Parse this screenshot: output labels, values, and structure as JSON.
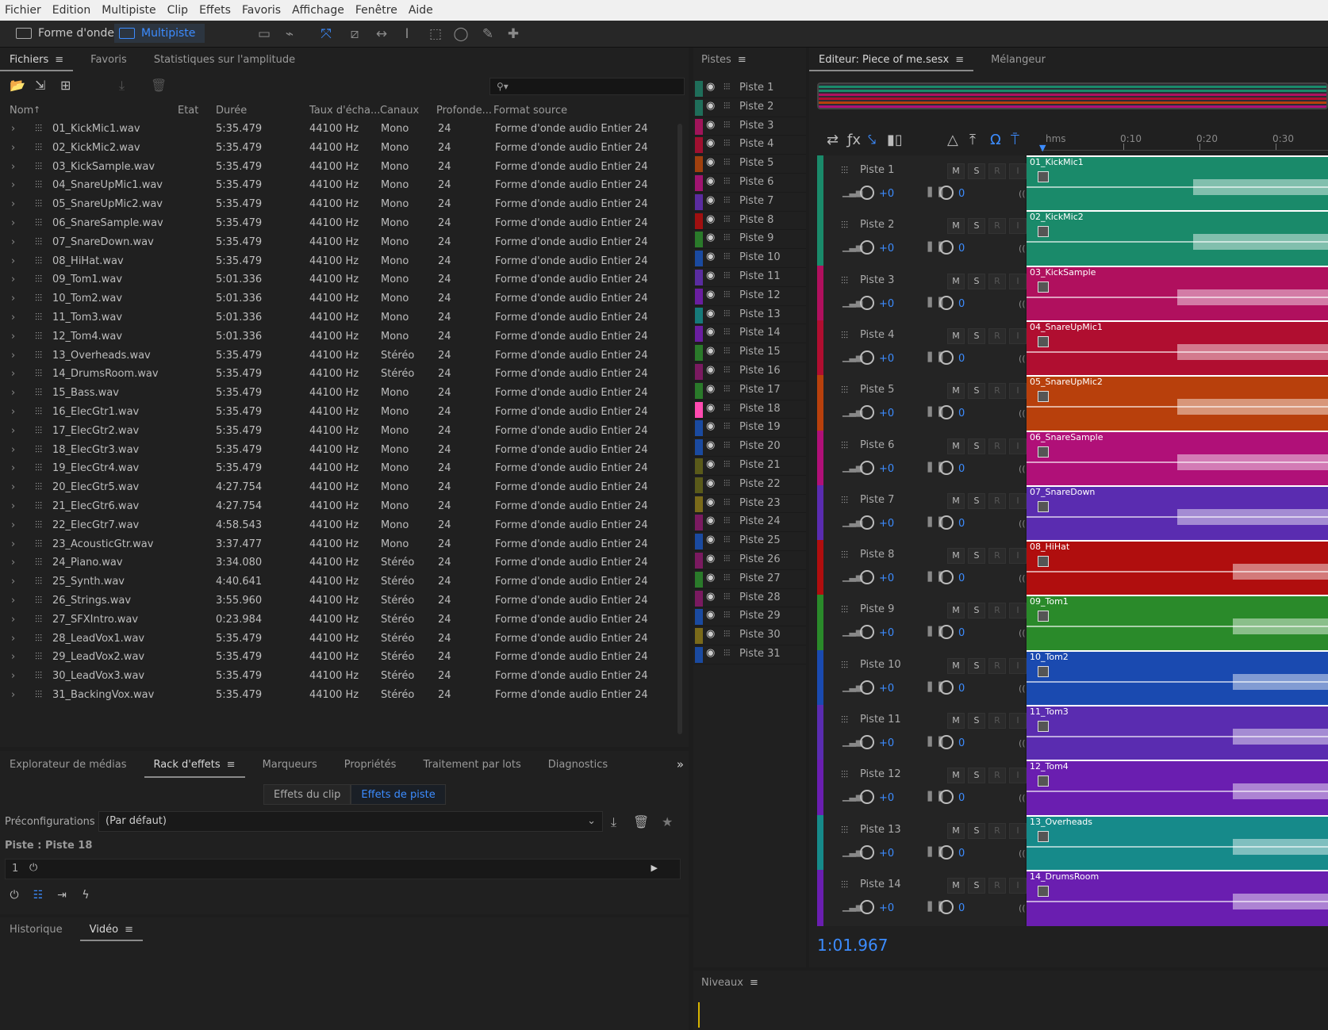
{
  "menu": [
    "Fichier",
    "Edition",
    "Multipiste",
    "Clip",
    "Effets",
    "Favoris",
    "Affichage",
    "Fenêtre",
    "Aide"
  ],
  "modes": {
    "waveform": "Forme d'onde",
    "multitrack": "Multipiste"
  },
  "files_panel": {
    "tabs": [
      "Fichiers",
      "Favoris",
      "Statistiques sur l'amplitude"
    ],
    "columns": [
      "Nom",
      "Etat",
      "Durée",
      "Taux d'écha...",
      "Canaux",
      "Profonde...",
      "Format source"
    ],
    "rows": [
      [
        "01_KickMic1.wav",
        "5:35.479",
        "44100 Hz",
        "Mono",
        "24",
        "Forme d'onde audio Entier 24"
      ],
      [
        "02_KickMic2.wav",
        "5:35.479",
        "44100 Hz",
        "Mono",
        "24",
        "Forme d'onde audio Entier 24"
      ],
      [
        "03_KickSample.wav",
        "5:35.479",
        "44100 Hz",
        "Mono",
        "24",
        "Forme d'onde audio Entier 24"
      ],
      [
        "04_SnareUpMic1.wav",
        "5:35.479",
        "44100 Hz",
        "Mono",
        "24",
        "Forme d'onde audio Entier 24"
      ],
      [
        "05_SnareUpMic2.wav",
        "5:35.479",
        "44100 Hz",
        "Mono",
        "24",
        "Forme d'onde audio Entier 24"
      ],
      [
        "06_SnareSample.wav",
        "5:35.479",
        "44100 Hz",
        "Mono",
        "24",
        "Forme d'onde audio Entier 24"
      ],
      [
        "07_SnareDown.wav",
        "5:35.479",
        "44100 Hz",
        "Mono",
        "24",
        "Forme d'onde audio Entier 24"
      ],
      [
        "08_HiHat.wav",
        "5:35.479",
        "44100 Hz",
        "Mono",
        "24",
        "Forme d'onde audio Entier 24"
      ],
      [
        "09_Tom1.wav",
        "5:01.336",
        "44100 Hz",
        "Mono",
        "24",
        "Forme d'onde audio Entier 24"
      ],
      [
        "10_Tom2.wav",
        "5:01.336",
        "44100 Hz",
        "Mono",
        "24",
        "Forme d'onde audio Entier 24"
      ],
      [
        "11_Tom3.wav",
        "5:01.336",
        "44100 Hz",
        "Mono",
        "24",
        "Forme d'onde audio Entier 24"
      ],
      [
        "12_Tom4.wav",
        "5:01.336",
        "44100 Hz",
        "Mono",
        "24",
        "Forme d'onde audio Entier 24"
      ],
      [
        "13_Overheads.wav",
        "5:35.479",
        "44100 Hz",
        "Stéréo",
        "24",
        "Forme d'onde audio Entier 24"
      ],
      [
        "14_DrumsRoom.wav",
        "5:35.479",
        "44100 Hz",
        "Stéréo",
        "24",
        "Forme d'onde audio Entier 24"
      ],
      [
        "15_Bass.wav",
        "5:35.479",
        "44100 Hz",
        "Mono",
        "24",
        "Forme d'onde audio Entier 24"
      ],
      [
        "16_ElecGtr1.wav",
        "5:35.479",
        "44100 Hz",
        "Mono",
        "24",
        "Forme d'onde audio Entier 24"
      ],
      [
        "17_ElecGtr2.wav",
        "5:35.479",
        "44100 Hz",
        "Mono",
        "24",
        "Forme d'onde audio Entier 24"
      ],
      [
        "18_ElecGtr3.wav",
        "5:35.479",
        "44100 Hz",
        "Mono",
        "24",
        "Forme d'onde audio Entier 24"
      ],
      [
        "19_ElecGtr4.wav",
        "5:35.479",
        "44100 Hz",
        "Mono",
        "24",
        "Forme d'onde audio Entier 24"
      ],
      [
        "20_ElecGtr5.wav",
        "4:27.754",
        "44100 Hz",
        "Mono",
        "24",
        "Forme d'onde audio Entier 24"
      ],
      [
        "21_ElecGtr6.wav",
        "4:27.754",
        "44100 Hz",
        "Mono",
        "24",
        "Forme d'onde audio Entier 24"
      ],
      [
        "22_ElecGtr7.wav",
        "4:58.543",
        "44100 Hz",
        "Mono",
        "24",
        "Forme d'onde audio Entier 24"
      ],
      [
        "23_AcousticGtr.wav",
        "3:37.477",
        "44100 Hz",
        "Mono",
        "24",
        "Forme d'onde audio Entier 24"
      ],
      [
        "24_Piano.wav",
        "3:34.080",
        "44100 Hz",
        "Stéréo",
        "24",
        "Forme d'onde audio Entier 24"
      ],
      [
        "25_Synth.wav",
        "4:40.641",
        "44100 Hz",
        "Stéréo",
        "24",
        "Forme d'onde audio Entier 24"
      ],
      [
        "26_Strings.wav",
        "3:55.960",
        "44100 Hz",
        "Stéréo",
        "24",
        "Forme d'onde audio Entier 24"
      ],
      [
        "27_SFXIntro.wav",
        "0:23.984",
        "44100 Hz",
        "Stéréo",
        "24",
        "Forme d'onde audio Entier 24"
      ],
      [
        "28_LeadVox1.wav",
        "5:35.479",
        "44100 Hz",
        "Stéréo",
        "24",
        "Forme d'onde audio Entier 24"
      ],
      [
        "29_LeadVox2.wav",
        "5:35.479",
        "44100 Hz",
        "Stéréo",
        "24",
        "Forme d'onde audio Entier 24"
      ],
      [
        "30_LeadVox3.wav",
        "5:35.479",
        "44100 Hz",
        "Stéréo",
        "24",
        "Forme d'onde audio Entier 24"
      ],
      [
        "31_BackingVox.wav",
        "5:35.479",
        "44100 Hz",
        "Stéréo",
        "24",
        "Forme d'onde audio Entier 24"
      ]
    ]
  },
  "rack": {
    "tabs": [
      "Explorateur de médias",
      "Rack d'effets",
      "Marqueurs",
      "Propriétés",
      "Traitement par lots",
      "Diagnostics"
    ],
    "subtabs": [
      "Effets du clip",
      "Effets de piste"
    ],
    "preset_label": "Préconfigurations :",
    "preset_value": "(Par défaut)",
    "track_label": "Piste : Piste 18",
    "slot_number": "1"
  },
  "bottom_tabs": [
    "Historique",
    "Vidéo"
  ],
  "tracks_panel": {
    "title": "Pistes",
    "tracks": [
      "Piste 1",
      "Piste 2",
      "Piste 3",
      "Piste 4",
      "Piste 5",
      "Piste 6",
      "Piste 7",
      "Piste 8",
      "Piste 9",
      "Piste 10",
      "Piste 11",
      "Piste 12",
      "Piste 13",
      "Piste 14",
      "Piste 15",
      "Piste 16",
      "Piste 17",
      "Piste 18",
      "Piste 19",
      "Piste 20",
      "Piste 21",
      "Piste 22",
      "Piste 23",
      "Piste 24",
      "Piste 25",
      "Piste 26",
      "Piste 27",
      "Piste 28",
      "Piste 29",
      "Piste 30",
      "Piste 31"
    ],
    "colors": [
      "#1f6e5a",
      "#1f6e5a",
      "#a0145a",
      "#a01030",
      "#a0400e",
      "#a01470",
      "#5a2ca0",
      "#a01010",
      "#2a7a2a",
      "#1a4aa0",
      "#5a2ca0",
      "#6a1ea0",
      "#167a7a",
      "#6a1ea0",
      "#2a7a2a",
      "#7a1a60",
      "#2a7a2a",
      "#ff4ab0",
      "#1a4aa0",
      "#1a4aa0",
      "#5a5a1a",
      "#5a5a1a",
      "#7a6a1a",
      "#7a1a60",
      "#1a4aa0",
      "#7a1a60",
      "#2a7a2a",
      "#7a1a60",
      "#1a4aa0",
      "#7a6a1a",
      "#1a4aa0"
    ]
  },
  "editor": {
    "tabs": [
      "Editeur: Piece of me.sesx",
      "Mélangeur"
    ],
    "ruler": [
      "hms",
      "0:10",
      "0:20",
      "0:30"
    ],
    "lanes": [
      {
        "name": "Piste 1",
        "clip": "01_KickMic1",
        "vol": "+0",
        "pan": "0",
        "color": "#1a8a6a"
      },
      {
        "name": "Piste 2",
        "clip": "02_KickMic2",
        "vol": "+0",
        "pan": "0",
        "color": "#1a8a6a"
      },
      {
        "name": "Piste 3",
        "clip": "03_KickSample",
        "vol": "+0",
        "pan": "0",
        "color": "#b0105e"
      },
      {
        "name": "Piste 4",
        "clip": "04_SnareUpMic1",
        "vol": "+0",
        "pan": "0",
        "color": "#b00e30"
      },
      {
        "name": "Piste 5",
        "clip": "05_SnareUpMic2",
        "vol": "+0",
        "pan": "0",
        "color": "#b8400c"
      },
      {
        "name": "Piste 6",
        "clip": "06_SnareSample",
        "vol": "+0",
        "pan": "0",
        "color": "#b01078"
      },
      {
        "name": "Piste 7",
        "clip": "07_SnareDown",
        "vol": "+0",
        "pan": "0",
        "color": "#5a2cb0"
      },
      {
        "name": "Piste 8",
        "clip": "08_HiHat",
        "vol": "+0",
        "pan": "0",
        "color": "#b00e0e"
      },
      {
        "name": "Piste 9",
        "clip": "09_Tom1",
        "vol": "+0",
        "pan": "0",
        "color": "#2a8a2a"
      },
      {
        "name": "Piste 10",
        "clip": "10_Tom2",
        "vol": "+0",
        "pan": "0",
        "color": "#1a4ab0"
      },
      {
        "name": "Piste 11",
        "clip": "11_Tom3",
        "vol": "+0",
        "pan": "0",
        "color": "#5a2cb0"
      },
      {
        "name": "Piste 12",
        "clip": "12_Tom4",
        "vol": "+0",
        "pan": "0",
        "color": "#6a1eb0"
      },
      {
        "name": "Piste 13",
        "clip": "13_Overheads",
        "vol": "+0",
        "pan": "0",
        "color": "#168a8a"
      },
      {
        "name": "Piste 14",
        "clip": "14_DrumsRoom",
        "vol": "+0",
        "pan": "0",
        "color": "#6a1eb0"
      }
    ],
    "msr": [
      "M",
      "S",
      "R",
      "I"
    ],
    "timecode": "1:01.967"
  },
  "levels": {
    "title": "Niveaux"
  }
}
